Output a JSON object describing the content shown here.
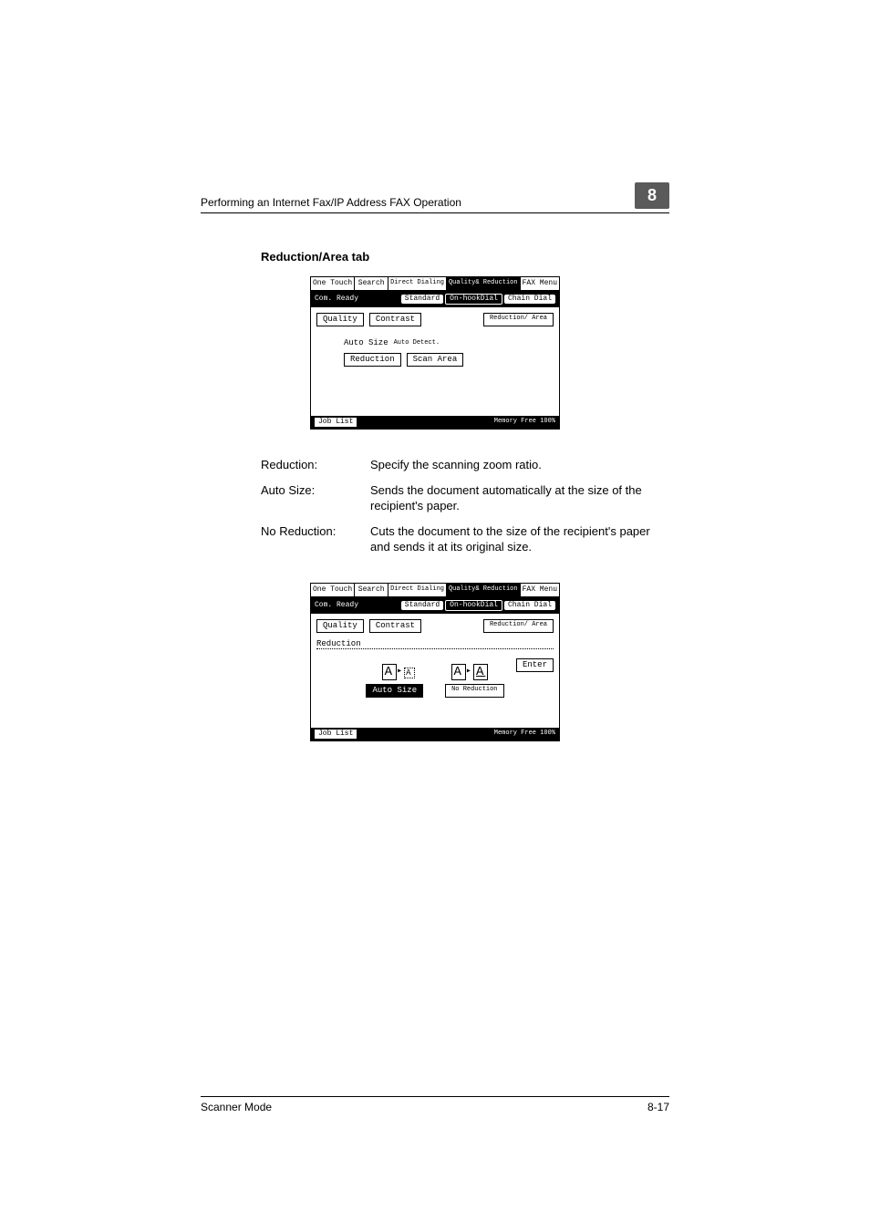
{
  "header": {
    "title": "Performing an Internet Fax/IP Address FAX Operation",
    "chapter": "8"
  },
  "section_heading": "Reduction/Area tab",
  "ui_common": {
    "tabs": [
      "One Touch",
      "Search",
      "Direct Dialing",
      "Quality& Reduction",
      "FAX Menu"
    ],
    "status": "Com. Ready",
    "status_pills": [
      "Standard",
      "On-hookDial",
      "Chain Dial"
    ],
    "subtabs": [
      "Quality",
      "Contrast",
      "Reduction/ Area"
    ],
    "job_list": "Job List",
    "memory": "Memory Free 100%"
  },
  "ui1": {
    "auto_size_label": "Auto Size",
    "auto_detect": "Auto Detect.",
    "reduction_btn": "Reduction",
    "scan_area_btn": "Scan Area"
  },
  "defs": [
    {
      "term": "Reduction:",
      "desc": "Specify the scanning zoom ratio."
    },
    {
      "term": "Auto Size:",
      "desc": "Sends the document automatically at the size of the recipient's paper."
    },
    {
      "term": "No Reduction:",
      "desc": "Cuts the document to the size of the recipient's paper and sends it at its original size."
    }
  ],
  "ui2": {
    "reduction_label": "Reduction",
    "enter": "Enter",
    "auto_size_btn": "Auto Size",
    "no_reduction_btn": "No Reduction"
  },
  "footer": {
    "left": "Scanner Mode",
    "right": "8-17"
  }
}
